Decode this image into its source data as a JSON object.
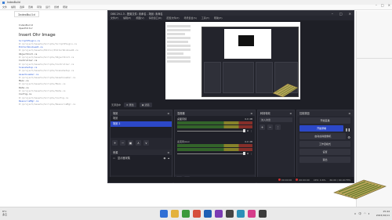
{
  "editor": {
    "window_title": "IndexBuild",
    "menu": [
      "文件",
      "编辑",
      "选择",
      "查看",
      "转到",
      "运行",
      "终端",
      "帮助"
    ],
    "tab_label": "IndexBuild",
    "lines": [
      {
        "text": "IndexBuild",
        "kind": "normal"
      },
      {
        "text": "OpenEditor",
        "kind": "normal"
      },
      {
        "text": "Insert Ohr Image",
        "kind": "heading"
      },
      {
        "text": "ScriptPlugin.cs",
        "kind": "link"
      },
      {
        "text": "D:/project/Assets/Scripts/ScriptPlugin.cs",
        "kind": "dim"
      },
      {
        "text": "EditorWindowUI.cs",
        "kind": "link"
      },
      {
        "text": "D:/project/Assets/Editor/EditorWindowUI.cs",
        "kind": "dim"
      },
      {
        "text": "ObjectInit.cs",
        "kind": "normal"
      },
      {
        "text": "D:/project/Assets/Scripts/ObjectInit.cs",
        "kind": "dim"
      },
      {
        "text": "Controller.cs",
        "kind": "normal"
      },
      {
        "text": "D:/project/Assets/Scripts/Controller.cs",
        "kind": "dim"
      },
      {
        "text": "SceneSetup.cs",
        "kind": "link"
      },
      {
        "text": "D:/project/Assets/Scripts/SceneSetup.cs",
        "kind": "dim"
      },
      {
        "text": "AssetLoader.cs",
        "kind": "link"
      },
      {
        "text": "D:/project/Assets/Scripts/AssetLoader.cs",
        "kind": "dim"
      },
      {
        "text": "Main.cs",
        "kind": "normal"
      },
      {
        "text": "D:/project/Assets/Scripts/Main.cs",
        "kind": "dim"
      },
      {
        "text": "Data.cs",
        "kind": "normal"
      },
      {
        "text": "D:/project/Assets/Scripts/Data.cs",
        "kind": "dim"
      },
      {
        "text": "Config.cs",
        "kind": "normal"
      },
      {
        "text": "D:/project/Assets/Scripts/Config.cs",
        "kind": "dim"
      },
      {
        "text": "ResourceMgr.cs",
        "kind": "link"
      },
      {
        "text": "D:/project/Assets/Scripts/ResourceMgr.cs",
        "kind": "dim"
      }
    ]
  },
  "obs": {
    "window_title": "OBS 29.1.3 - 配置文件: 未命名 - 场景: 未命名",
    "menu": [
      "文件(F)",
      "编辑(E)",
      "视图(V)",
      "停靠窗口(D)",
      "配置文件(P)",
      "场景集合(S)",
      "工具(T)",
      "帮助(H)"
    ],
    "toolbar": {
      "label": "无源选中",
      "properties": "属性",
      "filters": "滤镜"
    },
    "scenes": {
      "title": "场景",
      "items": [
        "场景",
        "场景 2"
      ],
      "selected": 1
    },
    "sources": {
      "title": "来源",
      "items": [
        "显示器采集"
      ]
    },
    "mixer": {
      "title": "混音器",
      "channels": [
        {
          "name": "桌面音频",
          "db": "0.0 dB"
        },
        {
          "name": "麦克风/Aux",
          "db": "0.0 dB"
        }
      ]
    },
    "transitions": {
      "title": "转场特效",
      "selected": "淡入淡出"
    },
    "controls": {
      "title": "控制按钮",
      "buttons": [
        "开始直播",
        "开始录制",
        "启动虚拟摄像机",
        "工作室模式",
        "设置",
        "退出"
      ],
      "primary_index": 1
    },
    "status": {
      "live": "00:00:00",
      "rec": "00:00:00",
      "cpu": "CPU: 0.6%",
      "fps": "60.00 / 60.00 FPS"
    }
  },
  "taskbar": {
    "weather_temp": "8°C",
    "weather_desc": "多云",
    "time": "15:44",
    "date": "2023/10/11",
    "lang": "中",
    "icon_colors": [
      "#2f6fd6",
      "#e3b23c",
      "#3c9a3c",
      "#d64f3c",
      "#1e5fb4",
      "#7a3cb4",
      "#444444",
      "#2c8fb8",
      "#d63c8a",
      "#3c3c3c"
    ]
  }
}
